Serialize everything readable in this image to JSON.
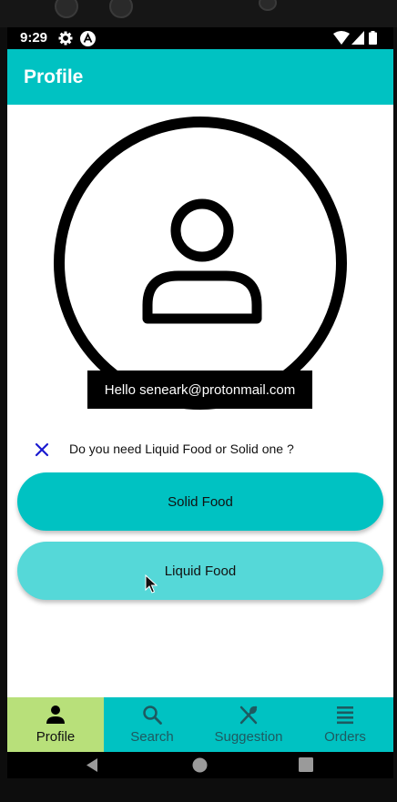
{
  "status": {
    "time": "9:29"
  },
  "appbar": {
    "title": "Profile"
  },
  "profile": {
    "greeting": "Hello seneark@protonmail.com"
  },
  "question": {
    "text": "Do you need Liquid Food or Solid one ?"
  },
  "options": {
    "solid_label": "Solid Food",
    "liquid_label": "Liquid Food"
  },
  "nav": {
    "active": "Profile",
    "items": [
      {
        "label": "Profile",
        "icon": "person-icon"
      },
      {
        "label": "Search",
        "icon": "search-icon"
      },
      {
        "label": "Suggestion",
        "icon": "utensils-icon"
      },
      {
        "label": "Orders",
        "icon": "list-icon"
      }
    ]
  },
  "colors": {
    "primary": "#00c2c2",
    "liquid_button": "#55d8d8",
    "nav_active": "#b8e07a",
    "close_icon": "#1a1ad0"
  }
}
